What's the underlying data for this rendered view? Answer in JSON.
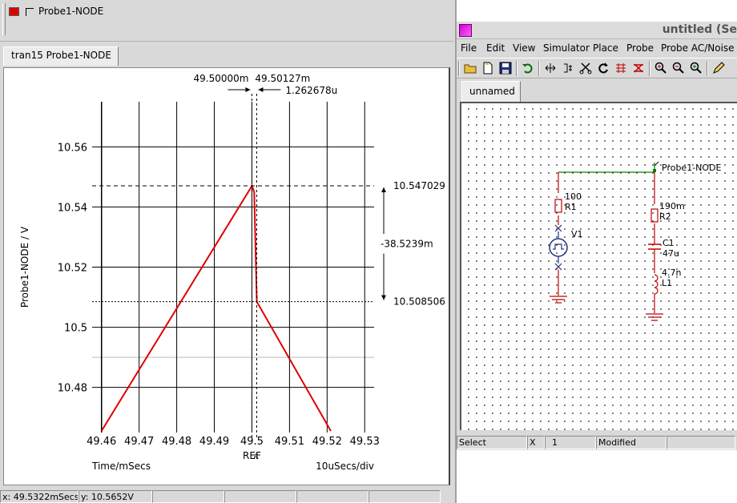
{
  "legend": {
    "trace_label": "Probe1-NODE",
    "trace_color": "#e00000"
  },
  "waveform_tab": {
    "label": "tran15 Probe1-NODE"
  },
  "plot": {
    "y_axis_label": "Probe1-NODE / V",
    "x_axis_label": "Time/mSecs",
    "x_scale_label": "10uSecs/div",
    "ref_marker_label": "REF",
    "cursor_marker_label": "A",
    "cursor_ref_time": "49.50000m",
    "cursor_a_time": "49.50127m",
    "cursor_delta_time": "1.262678u",
    "cursor_upper_value": "10.547029",
    "cursor_lower_value": "10.508506",
    "cursor_delta_value": "-38.5239m",
    "y_ticks": [
      "10.56",
      "10.54",
      "10.52",
      "10.5",
      "10.48"
    ],
    "x_ticks": [
      "49.46",
      "49.47",
      "49.48",
      "49.49",
      "49.5",
      "49.51",
      "49.52",
      "49.53"
    ]
  },
  "chart_data": {
    "type": "line",
    "title": "",
    "xlabel": "Time/mSecs",
    "ylabel": "Probe1-NODE / V",
    "xlim": [
      49.4575,
      49.5325
    ],
    "ylim": [
      10.465,
      10.575
    ],
    "y_grid_values": [
      10.48,
      10.5,
      10.52,
      10.54,
      10.56
    ],
    "x_grid_values": [
      49.46,
      49.47,
      49.48,
      49.49,
      49.5,
      49.51,
      49.52,
      49.53
    ],
    "grid": true,
    "series": [
      {
        "name": "Probe1-NODE",
        "color": "#e00000",
        "points": [
          [
            49.46,
            10.4655
          ],
          [
            49.5,
            10.547
          ],
          [
            49.5006,
            10.545
          ],
          [
            49.5013,
            10.5085
          ],
          [
            49.521,
            10.4655
          ]
        ]
      }
    ],
    "cursors": {
      "ref_x": 49.5,
      "a_x": 49.50127,
      "upper_y": 10.547029,
      "lower_y": 10.508506
    }
  },
  "left_status": {
    "x_readout": "x: 49.5322mSecs",
    "y_readout": "y: 10.5652V"
  },
  "editor": {
    "title": "untitled (Se",
    "menus": [
      "File",
      "Edit",
      "View",
      "Simulator",
      "Place",
      "Probe",
      "Probe AC/Noise"
    ],
    "toolbar_icons": [
      "open-icon",
      "new-icon",
      "save-icon",
      "undo-icon",
      "flip-icon",
      "rotate-icon",
      "cut-icon",
      "refresh-icon",
      "wire-icon",
      "delete-icon",
      "zoom-in-icon",
      "zoom-out-icon",
      "zoom-fit-icon",
      "pencil-icon"
    ],
    "tab_label": "unnamed",
    "status": {
      "mode": "Select",
      "x_label": "X",
      "x_value": "1",
      "state": "Modified"
    }
  },
  "schematic": {
    "probe_label": "Probe1-NODE",
    "r1_value": "100",
    "r1_name": "R1",
    "v1_name": "V1",
    "r2_value": "190m",
    "r2_name": "R2",
    "c1_name": "C1",
    "c1_value": "47u",
    "l1_value": "4.7n",
    "l1_name": "L1"
  }
}
